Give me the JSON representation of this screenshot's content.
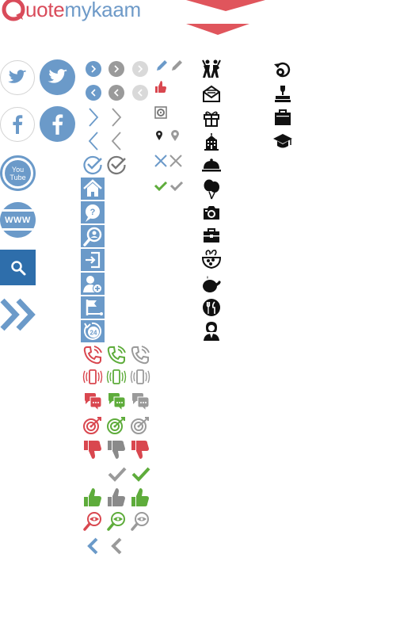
{
  "logo": {
    "part1": "uote",
    "part2": "mykaam",
    "brand_red": "#d94b5a",
    "brand_blue": "#6e9ac8"
  },
  "colors": {
    "blue": "#6b9ac9",
    "dark_blue": "#2e6eab",
    "red": "#d9474f",
    "green": "#5eac3b",
    "grey": "#9a9a9a",
    "light_grey": "#cfcfcf",
    "black": "#111111"
  },
  "icons": {
    "social": [
      "twitter-outline",
      "twitter-filled",
      "facebook-outline",
      "facebook-filled",
      "youtube",
      "www"
    ],
    "actions": [
      "search",
      "double-chevron-right"
    ],
    "nav": [
      "arrow-right-circle",
      "arrow-left-circle",
      "chevron-right",
      "chevron-left",
      "check-circle"
    ],
    "blue_tiles": [
      "home",
      "help-chat",
      "search-user",
      "sign-in",
      "add-user",
      "flag",
      "24-hours"
    ],
    "status": [
      "phone",
      "mobile-vibrate",
      "chat",
      "target",
      "thumbs-down",
      "check",
      "thumbs-up",
      "eye-search",
      "chevron-left"
    ],
    "misc": [
      "pencil",
      "thumb-up",
      "settings",
      "location",
      "close",
      "check-small"
    ],
    "categories_left": [
      "dance",
      "envelope",
      "gift",
      "building",
      "cloche",
      "balloons",
      "camera",
      "toolbox",
      "food-bowl",
      "roast-chicken",
      "restaurant",
      "person"
    ],
    "categories_right": [
      "refresh-gear",
      "stamp",
      "briefcase",
      "graduation-cap"
    ],
    "tile_text": {
      "help": "?",
      "hours": "24"
    },
    "youtube_text": {
      "line1": "You",
      "line2": "Tube"
    },
    "www_text": "WWW"
  }
}
